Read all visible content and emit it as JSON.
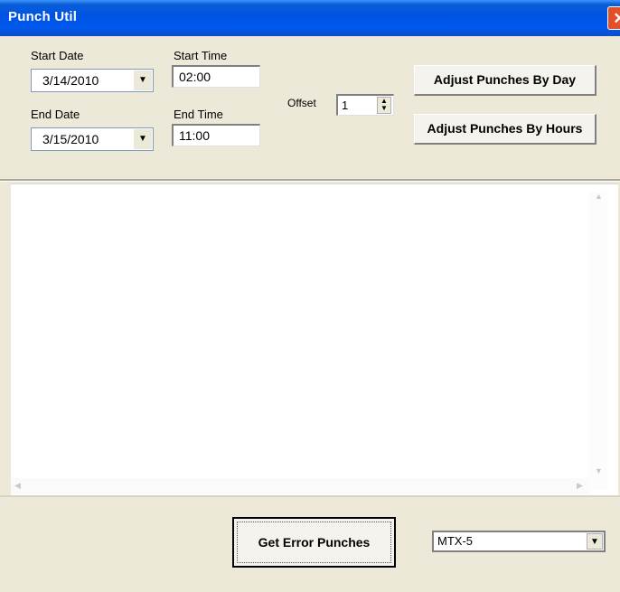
{
  "window": {
    "title": "Punch Util"
  },
  "filters": {
    "start_date_label": "Start Date",
    "start_date_value": "3/14/2010",
    "end_date_label": "End Date",
    "end_date_value": "3/15/2010",
    "start_time_label": "Start Time",
    "start_time_value": "02:00",
    "end_time_label": "End Time",
    "end_time_value": "11:00",
    "offset_label": "Offset",
    "offset_value": "1"
  },
  "actions": {
    "adjust_by_day": "Adjust Punches By Day",
    "adjust_by_hours": "Adjust Punches By Hours",
    "get_error_punches": "Get Error Punches"
  },
  "device_select": {
    "value": "MTX-5"
  },
  "icons": {
    "close": "close-icon",
    "dropdown": "chevron-down-icon",
    "spin_up": "arrow-up-icon",
    "spin_down": "arrow-down-icon"
  }
}
